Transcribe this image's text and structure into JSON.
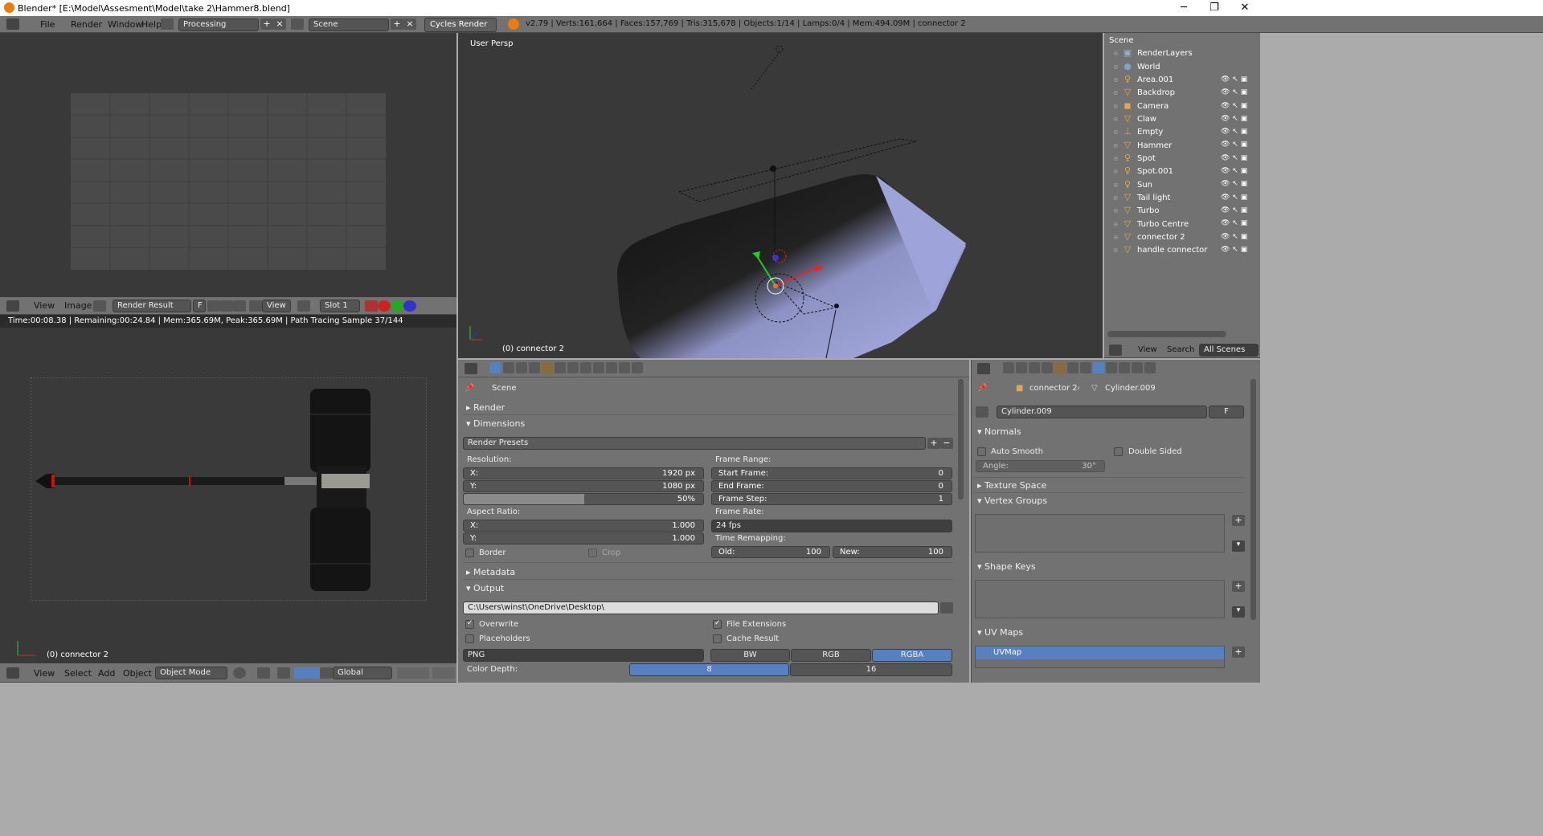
{
  "window": {
    "title": "Blender* [E:\\Model\\Assesment\\Model\\take 2\\Hammer8.blend]",
    "minimize": "─",
    "maximize": "❐",
    "close": "✕"
  },
  "menubar": {
    "items": [
      "File",
      "Render",
      "Window",
      "Help"
    ],
    "layout": "Processing",
    "scene": "Scene",
    "engine": "Cycles Render",
    "stats": "v2.79 | Verts:161,664 | Faces:157,769 | Tris:315,678 | Objects:1/14 | Lamps:0/4 | Mem:494.09M | connector 2"
  },
  "uv_editor": {
    "menu": [
      "View",
      "Image"
    ],
    "image": "Render Result",
    "fake": "F",
    "view": "View",
    "slot": "Slot 1",
    "status": "Time:00:08.38 | Remaining:00:24.84 | Mem:365.69M, Peak:365.69M | Path Tracing Sample 37/144"
  },
  "render_view": {
    "object_label": "(0) connector 2"
  },
  "viewport": {
    "label": "User Persp",
    "object_label": "(0) connector 2"
  },
  "bottom_header": {
    "menu": [
      "View",
      "Select",
      "Add",
      "Object"
    ],
    "mode": "Object Mode",
    "orientation": "Global"
  },
  "outliner": {
    "root": "Scene",
    "items": [
      {
        "name": "RenderLayers",
        "icon": "📷",
        "color": "#9bb0c8"
      },
      {
        "name": "World",
        "icon": "🌐",
        "color": "#7fa2c8"
      },
      {
        "name": "Area.001",
        "icon": "💡",
        "color": "#e8a64b"
      },
      {
        "name": "Backdrop",
        "icon": "▽",
        "color": "#e8a64b"
      },
      {
        "name": "Camera",
        "icon": "📷",
        "color": "#e8a64b"
      },
      {
        "name": "Claw",
        "icon": "▽",
        "color": "#e8a64b"
      },
      {
        "name": "Empty",
        "icon": "⊥",
        "color": "#e8a64b"
      },
      {
        "name": "Hammer",
        "icon": "▽",
        "color": "#e8a64b"
      },
      {
        "name": "Spot",
        "icon": "💡",
        "color": "#e8a64b"
      },
      {
        "name": "Spot.001",
        "icon": "💡",
        "color": "#e8a64b"
      },
      {
        "name": "Sun",
        "icon": "💡",
        "color": "#e8a64b"
      },
      {
        "name": "Tail light",
        "icon": "▽",
        "color": "#e8a64b"
      },
      {
        "name": "Turbo",
        "icon": "▽",
        "color": "#e8a64b"
      },
      {
        "name": "Turbo Centre",
        "icon": "▽",
        "color": "#e8a64b"
      },
      {
        "name": "connector 2",
        "icon": "▽",
        "color": "#e8a64b"
      },
      {
        "name": "handle connector",
        "icon": "▽",
        "color": "#e8a64b"
      }
    ],
    "footer": {
      "view": "View",
      "search": "Search",
      "filter": "All Scenes"
    }
  },
  "render_props": {
    "scene": "Scene",
    "panels": {
      "render": "Render",
      "dimensions": "Dimensions",
      "metadata": "Metadata",
      "output": "Output"
    },
    "presets": "Render Presets",
    "resolution_label": "Resolution:",
    "res_x_label": "X:",
    "res_x": "1920 px",
    "res_y_label": "Y:",
    "res_y": "1080 px",
    "res_pct": "50%",
    "aspect_label": "Aspect Ratio:",
    "asp_x_label": "X:",
    "asp_x": "1.000",
    "asp_y_label": "Y:",
    "asp_y": "1.000",
    "border": "Border",
    "crop": "Crop",
    "frame_range_label": "Frame Range:",
    "start_label": "Start Frame:",
    "start": "0",
    "end_label": "End Frame:",
    "end": "0",
    "step_label": "Frame Step:",
    "step": "1",
    "frame_rate_label": "Frame Rate:",
    "frame_rate": "24 fps",
    "remap_label": "Time Remapping:",
    "old_label": "Old:",
    "old": "100",
    "new_label": "New:",
    "new": "100",
    "path": "C:\\Users\\winst\\OneDrive\\Desktop\\",
    "overwrite": "Overwrite",
    "file_ext": "File Extensions",
    "placeholders": "Placeholders",
    "cache": "Cache Result",
    "format": "PNG",
    "color_modes": [
      "BW",
      "RGB",
      "RGBA"
    ],
    "color_depth_label": "Color Depth:",
    "depths": [
      "8",
      "16"
    ]
  },
  "data_props": {
    "object": "connector 2",
    "mesh": "Cylinder.009",
    "mesh_field": "Cylinder.009",
    "fake": "F",
    "normals": "Normals",
    "auto_smooth": "Auto Smooth",
    "double_sided": "Double Sided",
    "angle_label": "Angle:",
    "angle": "30°",
    "texture_space": "Texture Space",
    "vertex_groups": "Vertex Groups",
    "shape_keys": "Shape Keys",
    "uv_maps": "UV Maps",
    "uvmap": "UVMap"
  },
  "colors": {
    "accent": "#5680c2",
    "bg": "#727272",
    "viewport": "#393939",
    "mesh": "#a9aee3"
  }
}
